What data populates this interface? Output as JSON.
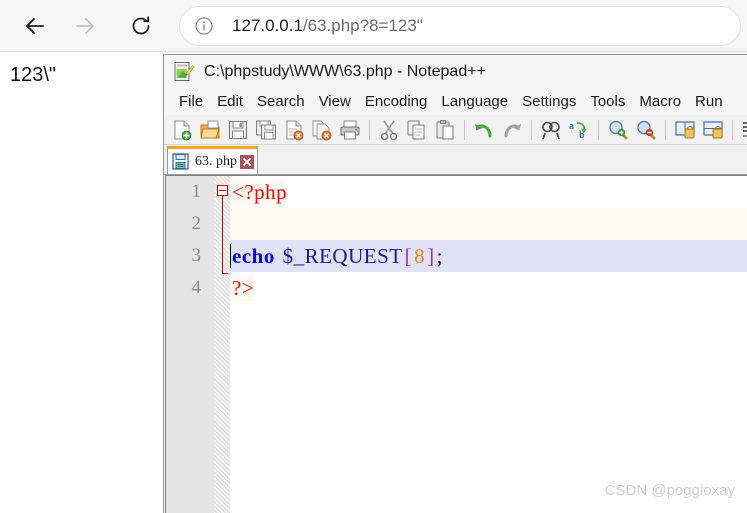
{
  "browser": {
    "nav": {
      "back_label": "Back",
      "forward_label": "Forward",
      "reload_label": "Reload"
    },
    "address": {
      "info_icon": "info-circle-icon",
      "host": "127.0.0.1",
      "path": "/63.php?8=123\"",
      "full_url": "127.0.0.1/63.php?8=123\""
    },
    "page": {
      "output": "123\\\""
    }
  },
  "notepad": {
    "app_icon": "notepad-plus-plus-icon",
    "title": "C:\\phpstudy\\WWW\\63.php - Notepad++",
    "menu": [
      "File",
      "Edit",
      "Search",
      "View",
      "Encoding",
      "Language",
      "Settings",
      "Tools",
      "Macro",
      "Run"
    ],
    "toolbar_icons": [
      "new-file-icon",
      "open-file-icon",
      "save-icon",
      "save-all-icon",
      "close-file-icon",
      "close-all-files-icon",
      "print-icon",
      "cut-icon",
      "copy-icon",
      "paste-icon",
      "undo-icon",
      "redo-icon",
      "find-icon",
      "replace-icon",
      "zoom-in-icon",
      "zoom-out-icon",
      "sync-vertical-scroll-icon",
      "sync-horizontal-scroll-icon",
      "word-wrap-icon",
      "show-all-characters-icon"
    ],
    "tab": {
      "save_state_icon": "saved-floppy-icon",
      "label": "63. php",
      "close_icon": "close-tab-icon"
    },
    "editor": {
      "lines": [
        {
          "num": "1",
          "tokens": [
            {
              "text": "<?php",
              "type": "tag"
            }
          ]
        },
        {
          "num": "2",
          "tokens": []
        },
        {
          "num": "3",
          "tokens": [
            {
              "text": "echo ",
              "type": "kw"
            },
            {
              "text": "$_REQUEST",
              "type": "var"
            },
            {
              "text": "[",
              "type": "brk"
            },
            {
              "text": "8",
              "type": "num"
            },
            {
              "text": "]",
              "type": "brk"
            },
            {
              "text": ";",
              "type": "punc"
            }
          ]
        },
        {
          "num": "4",
          "tokens": [
            {
              "text": "?>",
              "type": "tag"
            }
          ]
        }
      ],
      "plain_code": "<?php\n\necho $_REQUEST[8];\n?>",
      "current_line": 3,
      "fold_indicator": "collapse-fold-icon"
    }
  },
  "watermark": {
    "text": "CSDN @poggioxay"
  },
  "colors": {
    "php_block_bg": "#fffbf0",
    "current_line_bg": "#e2e2f6",
    "tag": "#ff0000",
    "keyword": "#0000ff",
    "variable": "#18189c",
    "bracket": "#9b30b0",
    "number": "#ff8000",
    "tab_active_accent": "#f5a623",
    "gutter_bg": "#e4e4e4"
  }
}
